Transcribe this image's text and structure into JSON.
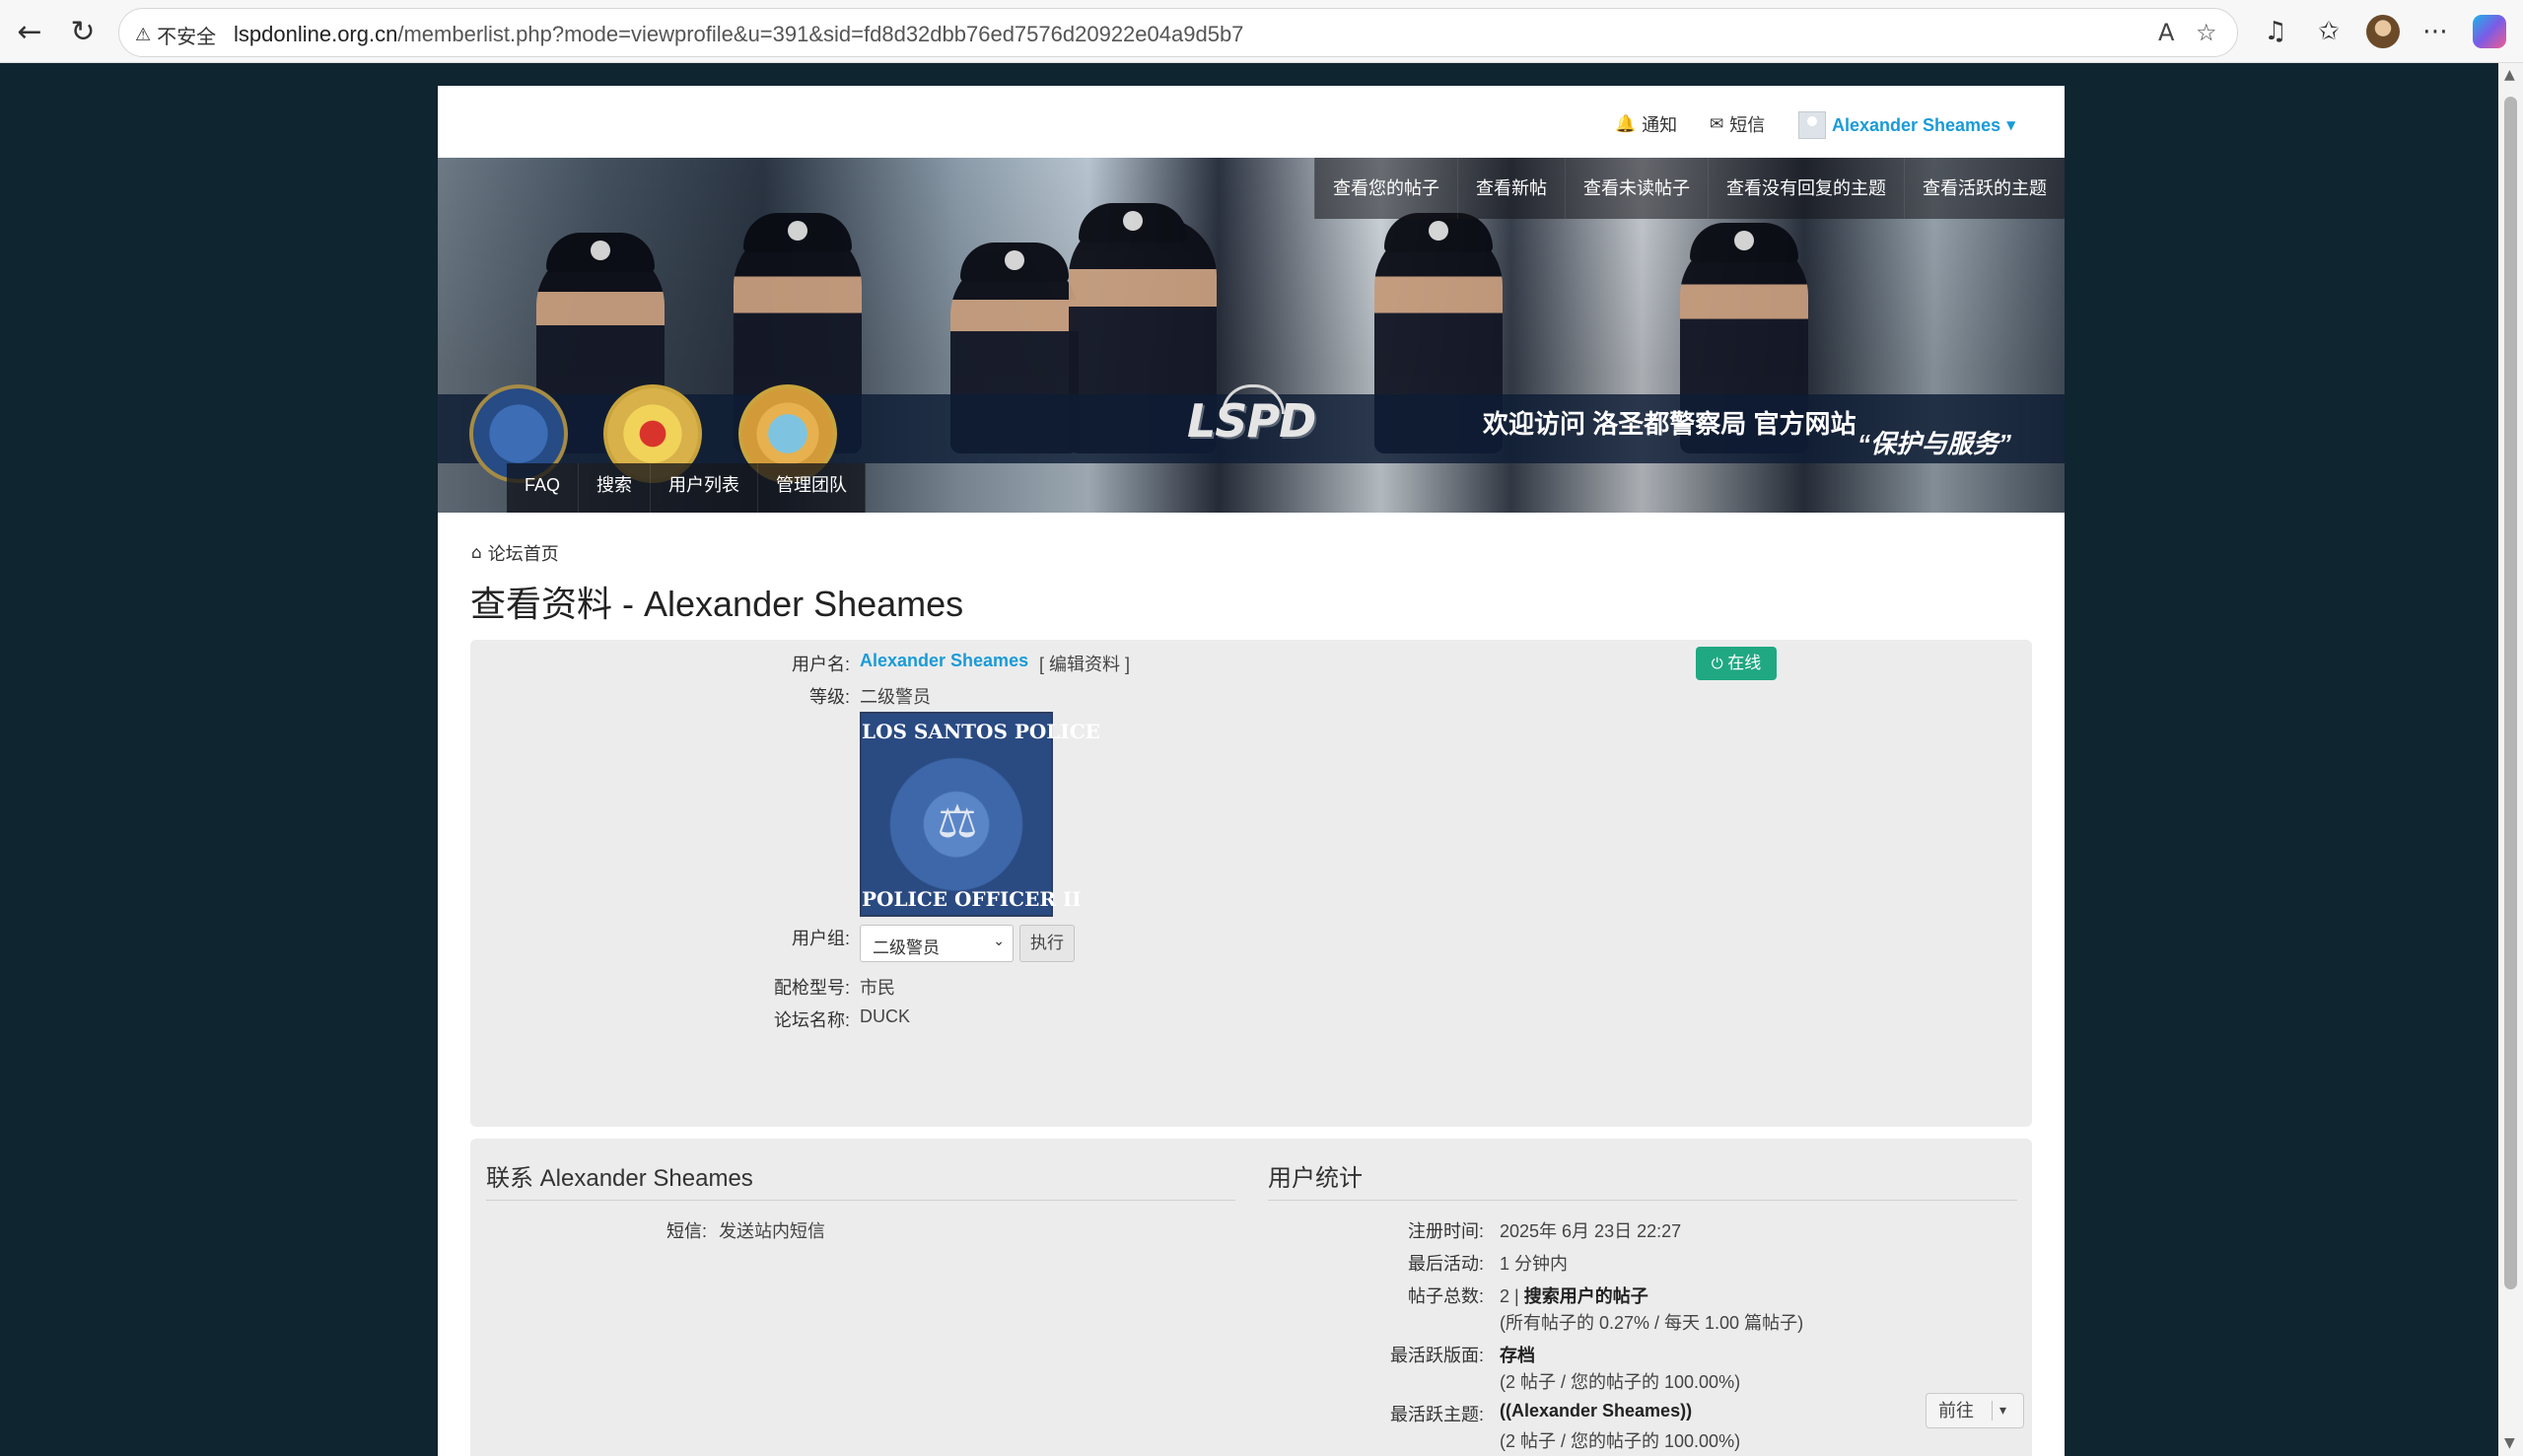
{
  "browser": {
    "security_label": "不安全",
    "url_host": "lspdonline.org.cn",
    "url_path": "/memberlist.php?mode=viewprofile&u=391&sid=fd8d32dbb76ed7576d20922e04a9d5b7"
  },
  "userbar": {
    "notifications": "通知",
    "messages": "短信",
    "username": "Alexander Sheames"
  },
  "banner": {
    "top_nav": [
      "查看您的帖子",
      "查看新帖",
      "查看未读帖子",
      "查看没有回复的主题",
      "查看活跃的主题"
    ],
    "logo_text": "LSPD",
    "welcome": "欢迎访问 洛圣都警察局 官方网站",
    "motto": "“保护与服务”",
    "sub_nav": [
      "FAQ",
      "搜索",
      "用户列表",
      "管理团队"
    ]
  },
  "breadcrumb": {
    "home": "论坛首页"
  },
  "page_title": "查看资料 - Alexander Sheames",
  "profile": {
    "username_label": "用户名:",
    "username": "Alexander Sheames",
    "edit_profile": "[ 编辑资料 ]",
    "rank_label": "等级:",
    "rank": "二级警员",
    "rank_image_top": "LOS SANTOS POLICE",
    "rank_image_bottom": "POLICE OFFICER II",
    "group_label": "用户组:",
    "group_selected": "二级警员",
    "execute_button": "执行",
    "weapon_label": "配枪型号:",
    "weapon": "市民",
    "forum_name_label": "论坛名称:",
    "forum_name": "DUCK",
    "online_badge": "在线"
  },
  "contact": {
    "title": "联系 Alexander Sheames",
    "pm_label": "短信:",
    "pm_value": "发送站内短信"
  },
  "stats": {
    "title": "用户统计",
    "joined_label": "注册时间:",
    "joined": "2025年 6月 23日 22:27",
    "last_active_label": "最后活动:",
    "last_active": "1 分钟内",
    "posts_label": "帖子总数:",
    "posts_count": "2 |",
    "posts_search": "搜索用户的帖子",
    "posts_detail": "(所有帖子的 0.27% / 每天 1.00 篇帖子)",
    "active_forum_label": "最活跃版面:",
    "active_forum": "存档",
    "active_forum_detail": "(2 帖子 / 您的帖子的 100.00%)",
    "active_topic_label": "最活跃主题:",
    "active_topic": "((Alexander Sheames))",
    "active_topic_detail": "(2 帖子 / 您的帖子的 100.00%)"
  },
  "jump_button": "前往",
  "colors": {
    "link": "#1a9bd7",
    "online_badge": "#20a883",
    "page_background": "#0f2530"
  }
}
